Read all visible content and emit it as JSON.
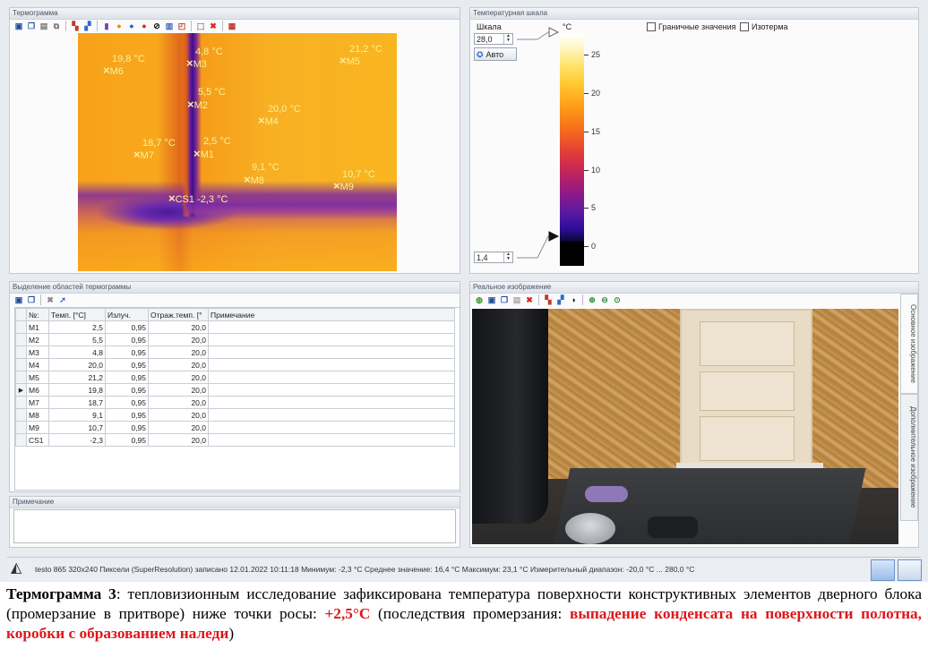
{
  "thermogram_panel": {
    "title": "Термограмма"
  },
  "markers": [
    {
      "id": "M6",
      "value": "19,8 °C"
    },
    {
      "id": "M3",
      "value": "4,8 °C"
    },
    {
      "id": "M5",
      "value": "21,2 °C"
    },
    {
      "id": "M2",
      "value": "5,5 °C"
    },
    {
      "id": "M4",
      "value": "20,0 °C"
    },
    {
      "id": "M7",
      "value": "18,7 °C"
    },
    {
      "id": "M1",
      "value": "2,5 °C"
    },
    {
      "id": "M8",
      "value": "9,1 °C"
    },
    {
      "id": "M9",
      "value": "10,7 °C"
    },
    {
      "id": "CS1",
      "value": "-2,3 °C"
    }
  ],
  "scale_panel": {
    "title": "Температурная шкала",
    "scale_label": "Шкала",
    "max_value": "28,0",
    "min_value": "1,4",
    "auto_button": "Авто",
    "unit": "°C",
    "ticks": [
      "25",
      "20",
      "15",
      "10",
      "5",
      "0"
    ],
    "checkbox_limits": "Граничные значения",
    "checkbox_isotherm": "Изотерма",
    "colors": {
      "top": "#ffffff",
      "mid": "#e03a3a",
      "bottom": "#000000"
    }
  },
  "regions_panel": {
    "title": "Выделение областей термограммы",
    "columns": [
      "№:",
      "Темп. [°C]",
      "Излуч.",
      "Отраж.темп. [°",
      "Примечание"
    ],
    "rows": [
      [
        "M1",
        "2,5",
        "0,95",
        "20,0",
        ""
      ],
      [
        "M2",
        "5,5",
        "0,95",
        "20,0",
        ""
      ],
      [
        "M3",
        "4,8",
        "0,95",
        "20,0",
        ""
      ],
      [
        "M4",
        "20,0",
        "0,95",
        "20,0",
        ""
      ],
      [
        "M5",
        "21,2",
        "0,95",
        "20,0",
        ""
      ],
      [
        "M6",
        "19,8",
        "0,95",
        "20,0",
        ""
      ],
      [
        "M7",
        "18,7",
        "0,95",
        "20,0",
        ""
      ],
      [
        "M8",
        "9,1",
        "0,95",
        "20,0",
        ""
      ],
      [
        "M9",
        "10,7",
        "0,95",
        "20,0",
        ""
      ],
      [
        "CS1",
        "-2,3",
        "0,95",
        "20,0",
        ""
      ]
    ],
    "selected_row": "M6"
  },
  "note_panel": {
    "title": "Примечание",
    "text": ""
  },
  "real_image_panel": {
    "title": "Реальное изображение",
    "tab_main": "Основное изображение",
    "tab_extra": "Дополнительное изображение"
  },
  "status_bar": {
    "text": "testo 865 320x240 Пиксели (SuperResolution) записано 12.01.2022 10:11:18 Минимум: -2,3 °C Среднее значение: 16,4 °C Максимум: 23,1 °C Измерительный диапазон: -20,0 °C ... 280,0 °C"
  },
  "caption": {
    "label": "Термограмма 3",
    "text1": ": тепловизионным исследование зафиксирована температура поверхности конструктивных элементов дверного блока (промерзание в притворе) ниже точки росы: ",
    "temp": "+2,5°С",
    "text2": " (последствия промерзания: ",
    "consequence": "выпадение конденсата на поверхности полотна, коробки с образованием наледи",
    "text3": ")"
  }
}
